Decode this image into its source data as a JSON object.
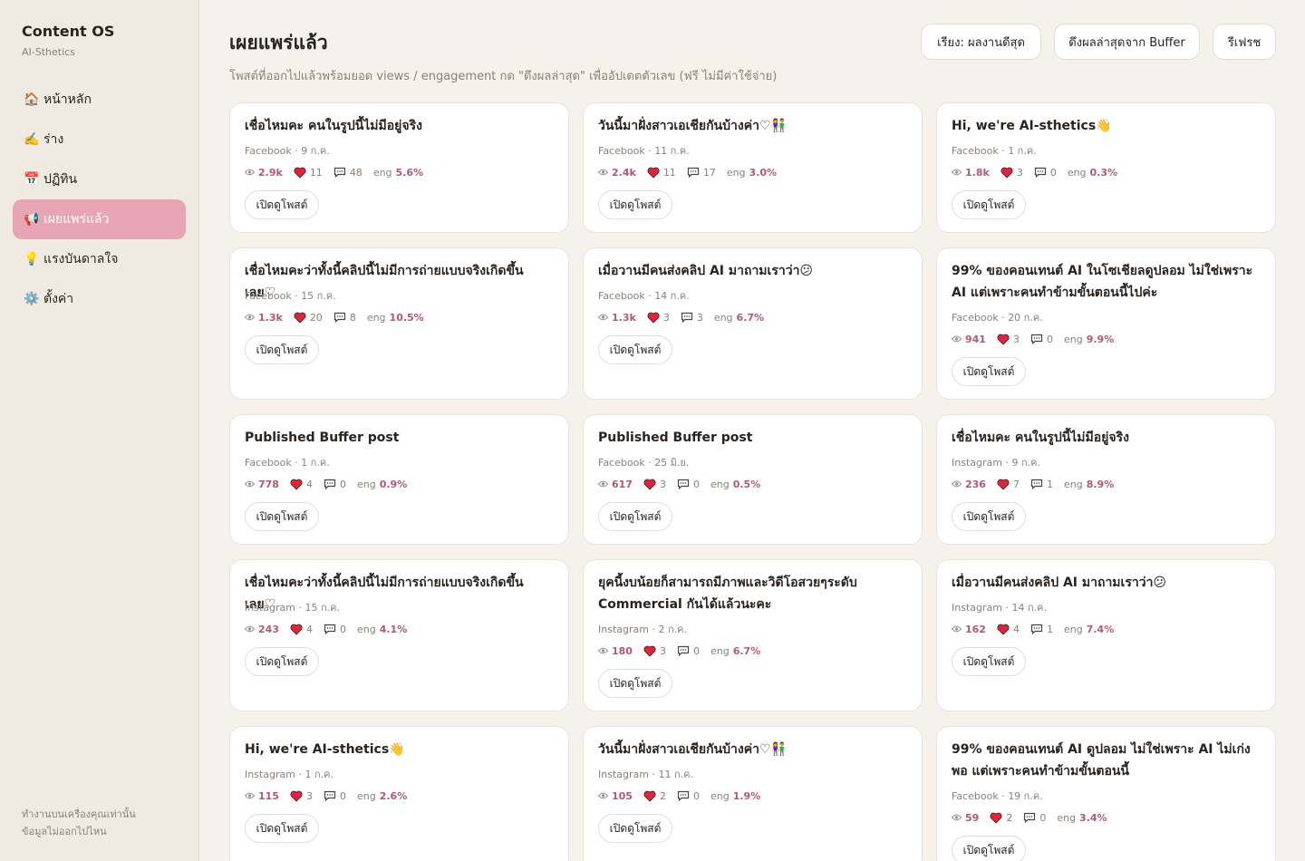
{
  "app": {
    "title": "Content OS",
    "subtitle": "AI-Sthetics"
  },
  "nav": [
    {
      "icon": "home-icon",
      "glyph": "🏠",
      "label": "หน้าหลัก",
      "active": false
    },
    {
      "icon": "writing-hand-icon",
      "glyph": "✍️",
      "label": "ร่าง",
      "active": false
    },
    {
      "icon": "calendar-icon",
      "glyph": "📅",
      "label": "ปฏิทิน",
      "active": false
    },
    {
      "icon": "megaphone-icon",
      "glyph": "📢",
      "label": "เผยแพร่แล้ว",
      "active": true
    },
    {
      "icon": "lightbulb-icon",
      "glyph": "💡",
      "label": "แรงบันดาลใจ",
      "active": false
    },
    {
      "icon": "gear-icon",
      "glyph": "⚙️",
      "label": "ตั้งค่า",
      "active": false
    }
  ],
  "footer": {
    "line1": "ทำงานบนเครื่องคุณเท่านั้น",
    "line2": "ข้อมูลไม่ออกไปไหน"
  },
  "header": {
    "title": "เผยแพร่แล้ว",
    "subtitle": "โพสต์ที่ออกไปแล้วพร้อมยอด views / engagement กด \"ดึงผลล่าสุด\" เพื่ออัปเดตตัวเลข (ฟรี ไม่มีค่าใช้จ่าย)",
    "sort_label": "เรียง: ผลงานดีสุด",
    "fetch_label": "ดึงผลล่าสุดจาก Buffer",
    "refresh_label": "รีเฟรช"
  },
  "open_label": "เปิดดูโพสต์",
  "eng_label": "eng",
  "colors": {
    "accent": "#e8a5b5",
    "metric": "#b05a72",
    "heart": "#e0243c"
  },
  "posts": [
    {
      "title": "เชื่อไหมคะ คนในรูปนี้ไม่มีอยู่จริง",
      "platform": "Facebook",
      "date": "9 ก.ค.",
      "views": "2.9k",
      "likes": "11",
      "comments": "48",
      "eng": "5.6%"
    },
    {
      "title": "วันนี้มาฝั่งสาวเอเชียกันบ้างค่า♡👫",
      "platform": "Facebook",
      "date": "11 ก.ค.",
      "views": "2.4k",
      "likes": "11",
      "comments": "17",
      "eng": "3.0%"
    },
    {
      "title": "Hi, we're AI-sthetics👋",
      "platform": "Facebook",
      "date": "1 ก.ค.",
      "views": "1.8k",
      "likes": "3",
      "comments": "0",
      "eng": "0.3%"
    },
    {
      "title": "เชื่อไหมคะว่าทั้งนี้คลิปนี้ไม่มีการถ่ายแบบจริงเกิดขึ้นเลย♡",
      "platform": "Facebook",
      "date": "15 ก.ค.",
      "views": "1.3k",
      "likes": "20",
      "comments": "8",
      "eng": "10.5%"
    },
    {
      "title": "เมื่อวานมีคนส่งคลิป AI มาถามเราว่า😕",
      "platform": "Facebook",
      "date": "14 ก.ค.",
      "views": "1.3k",
      "likes": "3",
      "comments": "3",
      "eng": "6.7%"
    },
    {
      "title": "99% ของคอนเทนต์ AI ในโซเชียลดูปลอม ไม่ใช่เพราะ AI แต่เพราะคนทำข้ามขั้นตอนนี้ไปค่ะ",
      "platform": "Facebook",
      "date": "20 ก.ค.",
      "views": "941",
      "likes": "3",
      "comments": "0",
      "eng": "9.9%"
    },
    {
      "title": "Published Buffer post",
      "platform": "Facebook",
      "date": "1 ก.ค.",
      "views": "778",
      "likes": "4",
      "comments": "0",
      "eng": "0.9%"
    },
    {
      "title": "Published Buffer post",
      "platform": "Facebook",
      "date": "25 มิ.ย.",
      "views": "617",
      "likes": "3",
      "comments": "0",
      "eng": "0.5%"
    },
    {
      "title": "เชื่อไหมคะ คนในรูปนี้ไม่มีอยู่จริง",
      "platform": "Instagram",
      "date": "9 ก.ค.",
      "views": "236",
      "likes": "7",
      "comments": "1",
      "eng": "8.9%"
    },
    {
      "title": "เชื่อไหมคะว่าทั้งนี้คลิปนี้ไม่มีการถ่ายแบบจริงเกิดขึ้นเลย♡",
      "platform": "Instagram",
      "date": "15 ก.ค.",
      "views": "243",
      "likes": "4",
      "comments": "0",
      "eng": "4.1%"
    },
    {
      "title": "ยุคนี้งบน้อยก็สามารถมีภาพและวิดีโอสวยๆระดับ Commercial กันได้แล้วนะคะ",
      "platform": "Instagram",
      "date": "2 ก.ค.",
      "views": "180",
      "likes": "3",
      "comments": "0",
      "eng": "6.7%"
    },
    {
      "title": "เมื่อวานมีคนส่งคลิป AI มาถามเราว่า😕",
      "platform": "Instagram",
      "date": "14 ก.ค.",
      "views": "162",
      "likes": "4",
      "comments": "1",
      "eng": "7.4%"
    },
    {
      "title": "Hi, we're AI-sthetics👋",
      "platform": "Instagram",
      "date": "1 ก.ค.",
      "views": "115",
      "likes": "3",
      "comments": "0",
      "eng": "2.6%"
    },
    {
      "title": "วันนี้มาฝั่งสาวเอเชียกันบ้างค่า♡👫",
      "platform": "Instagram",
      "date": "11 ก.ค.",
      "views": "105",
      "likes": "2",
      "comments": "0",
      "eng": "1.9%"
    },
    {
      "title": "99% ของคอนเทนต์ AI ดูปลอม ไม่ใช่เพราะ AI ไม่เก่งพอ แต่เพราะคนทำข้ามขั้นตอนนี้",
      "platform": "Facebook",
      "date": "19 ก.ค.",
      "views": "59",
      "likes": "2",
      "comments": "0",
      "eng": "3.4%"
    }
  ]
}
